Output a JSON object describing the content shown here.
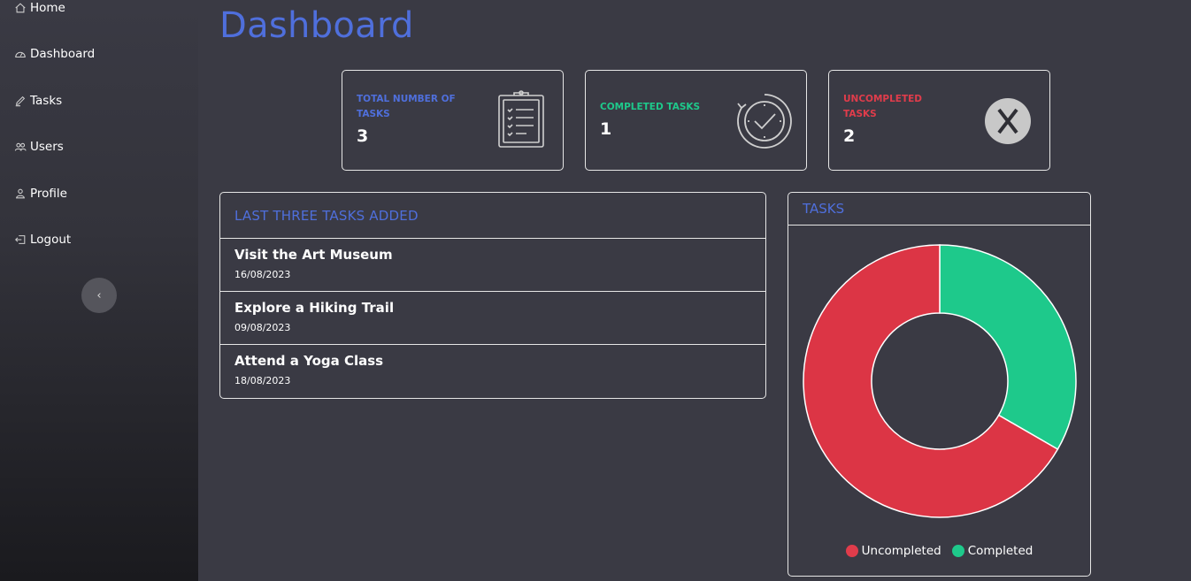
{
  "sidebar": {
    "items": [
      {
        "label": "Home",
        "icon": "home-icon"
      },
      {
        "label": "Dashboard",
        "icon": "gauge-icon"
      },
      {
        "label": "Tasks",
        "icon": "pencil-icon"
      },
      {
        "label": "Users",
        "icon": "users-icon"
      },
      {
        "label": "Profile",
        "icon": "person-icon"
      },
      {
        "label": "Logout",
        "icon": "logout-icon"
      }
    ],
    "collapse_label": "‹"
  },
  "header": {
    "title": "Dashboard"
  },
  "stats": [
    {
      "label": "TOTAL NUMBER OF TASKS",
      "value": "3",
      "color": "#4f6fdc",
      "icon": "clipboard-icon"
    },
    {
      "label": "COMPLETED TASKS",
      "value": "1",
      "color": "#1ec98b",
      "icon": "check-clock-icon"
    },
    {
      "label": "UNCOMPLETED TASKS",
      "value": "2",
      "color": "#e03c4b",
      "icon": "x-circle-icon"
    }
  ],
  "recent": {
    "title": "LAST THREE TASKS ADDED",
    "tasks": [
      {
        "title": "Visit the Art Museum",
        "date": "16/08/2023"
      },
      {
        "title": "Explore a Hiking Trail",
        "date": "09/08/2023"
      },
      {
        "title": "Attend a Yoga Class",
        "date": "18/08/2023"
      }
    ]
  },
  "chart_panel": {
    "title": "TASKS"
  },
  "chart_data": {
    "type": "pie",
    "donut": true,
    "categories": [
      "Uncompleted",
      "Completed"
    ],
    "values": [
      2,
      1
    ],
    "colors": [
      "#dc3545",
      "#1ec98b"
    ],
    "legend": "bottom"
  },
  "colors": {
    "accent": "#4f6fdc",
    "background": "#3a3a44",
    "success": "#1ec98b",
    "danger": "#e03c4b"
  }
}
